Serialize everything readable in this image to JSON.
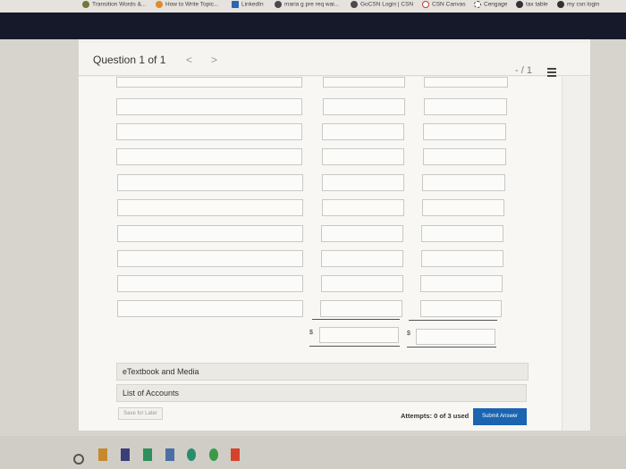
{
  "bookmarks": [
    {
      "label": "Transition Words &...",
      "icon": "bookmark-icon",
      "color": "#6b7a3a"
    },
    {
      "label": "How to Write Topic...",
      "icon": "globe-icon",
      "color": "#e08a2a"
    },
    {
      "label": "LinkedIn",
      "icon": "linkedin-icon",
      "color": "#2867b2"
    },
    {
      "label": "maria g pre req wai...",
      "icon": "puzzle-icon",
      "color": "#4a4a4a"
    },
    {
      "label": "GoCSN Login | CSN",
      "icon": "puzzle-icon",
      "color": "#4a4a4a"
    },
    {
      "label": "CSN Canvas",
      "icon": "canvas-icon",
      "color": "#c0392b"
    },
    {
      "label": "Cengage",
      "icon": "cengage-icon",
      "color": "#4a4a4a"
    },
    {
      "label": "tax table",
      "icon": "globe-icon",
      "color": "#333333"
    },
    {
      "label": "my csn login",
      "icon": "globe-icon",
      "color": "#333333"
    }
  ],
  "question": {
    "title": "Question 1 of 1",
    "prev": "<",
    "next": ">",
    "score": "- / 1"
  },
  "currency_symbol": "$",
  "resources": {
    "textbook": "eTextbook and Media",
    "accounts": "List of Accounts"
  },
  "footer": {
    "save_label": "Save for Later",
    "attempts": "Attempts: 0 of 3 used",
    "submit_label": "Submit Answer"
  },
  "colors": {
    "header_dark": "#161929",
    "submit_blue": "#1b64b0"
  }
}
